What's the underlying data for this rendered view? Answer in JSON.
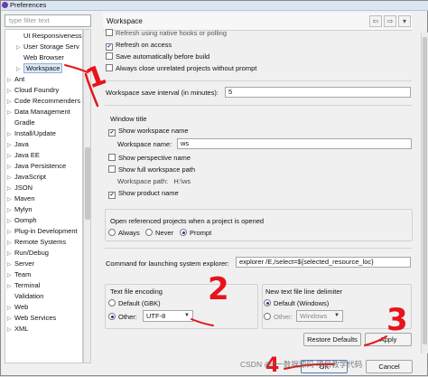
{
  "window": {
    "title": "Preferences"
  },
  "filter": {
    "placeholder": "type filter text"
  },
  "tree": [
    {
      "label": "UI Responsiveness",
      "indent": 1,
      "arrow": false
    },
    {
      "label": "User Storage Serv",
      "indent": 1,
      "arrow": true
    },
    {
      "label": "Web Browser",
      "indent": 1,
      "arrow": false
    },
    {
      "label": "Workspace",
      "indent": 1,
      "arrow": true,
      "selected": true
    },
    {
      "label": "Ant",
      "indent": 0,
      "arrow": true
    },
    {
      "label": "Cloud Foundry",
      "indent": 0,
      "arrow": true
    },
    {
      "label": "Code Recommenders",
      "indent": 0,
      "arrow": true
    },
    {
      "label": "Data Management",
      "indent": 0,
      "arrow": true
    },
    {
      "label": "Gradle",
      "indent": 0,
      "arrow": false
    },
    {
      "label": "Install/Update",
      "indent": 0,
      "arrow": true
    },
    {
      "label": "Java",
      "indent": 0,
      "arrow": true
    },
    {
      "label": "Java EE",
      "indent": 0,
      "arrow": true
    },
    {
      "label": "Java Persistence",
      "indent": 0,
      "arrow": true
    },
    {
      "label": "JavaScript",
      "indent": 0,
      "arrow": true
    },
    {
      "label": "JSON",
      "indent": 0,
      "arrow": true
    },
    {
      "label": "Maven",
      "indent": 0,
      "arrow": true
    },
    {
      "label": "Mylyn",
      "indent": 0,
      "arrow": true
    },
    {
      "label": "Oomph",
      "indent": 0,
      "arrow": true
    },
    {
      "label": "Plug-in Development",
      "indent": 0,
      "arrow": true
    },
    {
      "label": "Remote Systems",
      "indent": 0,
      "arrow": true
    },
    {
      "label": "Run/Debug",
      "indent": 0,
      "arrow": true
    },
    {
      "label": "Server",
      "indent": 0,
      "arrow": true
    },
    {
      "label": "Team",
      "indent": 0,
      "arrow": true
    },
    {
      "label": "Terminal",
      "indent": 0,
      "arrow": true
    },
    {
      "label": "Validation",
      "indent": 0,
      "arrow": false
    },
    {
      "label": "Web",
      "indent": 0,
      "arrow": true
    },
    {
      "label": "Web Services",
      "indent": 0,
      "arrow": true
    },
    {
      "label": "XML",
      "indent": 0,
      "arrow": true
    }
  ],
  "header": {
    "title": "Workspace",
    "back": "⇦",
    "forward": "⇨",
    "menu": "▾"
  },
  "workspace": {
    "refresh_hooks": "Refresh using native hooks or polling",
    "refresh_access": "Refresh on access",
    "save_auto": "Save automatically before build",
    "close_unrelated": "Always close unrelated projects without prompt",
    "save_interval_label": "Workspace save interval (in minutes):",
    "save_interval_value": "5",
    "window_title_label": "Window title",
    "show_ws_name": "Show workspace name",
    "ws_name_label": "Workspace name:",
    "ws_name_value": "ws",
    "show_perspective": "Show perspective name",
    "show_full_path": "Show full workspace path",
    "ws_path_label": "Workspace path:",
    "ws_path_value": "H:\\ws",
    "show_product": "Show product name",
    "open_ref_label": "Open referenced projects when a project is opened",
    "radio_always": "Always",
    "radio_never": "Never",
    "radio_prompt": "Prompt",
    "launch_cmd_label": "Command for launching system explorer:",
    "launch_cmd_value": "explorer /E,/select=${selected_resource_loc}",
    "encoding_label": "Text file encoding",
    "enc_default": "Default (GBK)",
    "enc_other": "Other:",
    "enc_value": "UTF-8",
    "delim_label": "New text file line delimiter",
    "delim_default": "Default (Windows)",
    "delim_other": "Other:",
    "delim_value": "Windows"
  },
  "buttons": {
    "restore": "Restore Defaults",
    "apply": "Apply",
    "ok": "OK",
    "cancel": "Cancel"
  },
  "annotations": {
    "one": "1",
    "two": "2",
    "three": "3",
    "four": "4"
  },
  "watermark": "CSDN @it一数据源码 项目教学代码",
  "colors": {
    "annotation": "#e8141b",
    "selection": "#dde8f6",
    "accent": "#1b3b8c"
  }
}
